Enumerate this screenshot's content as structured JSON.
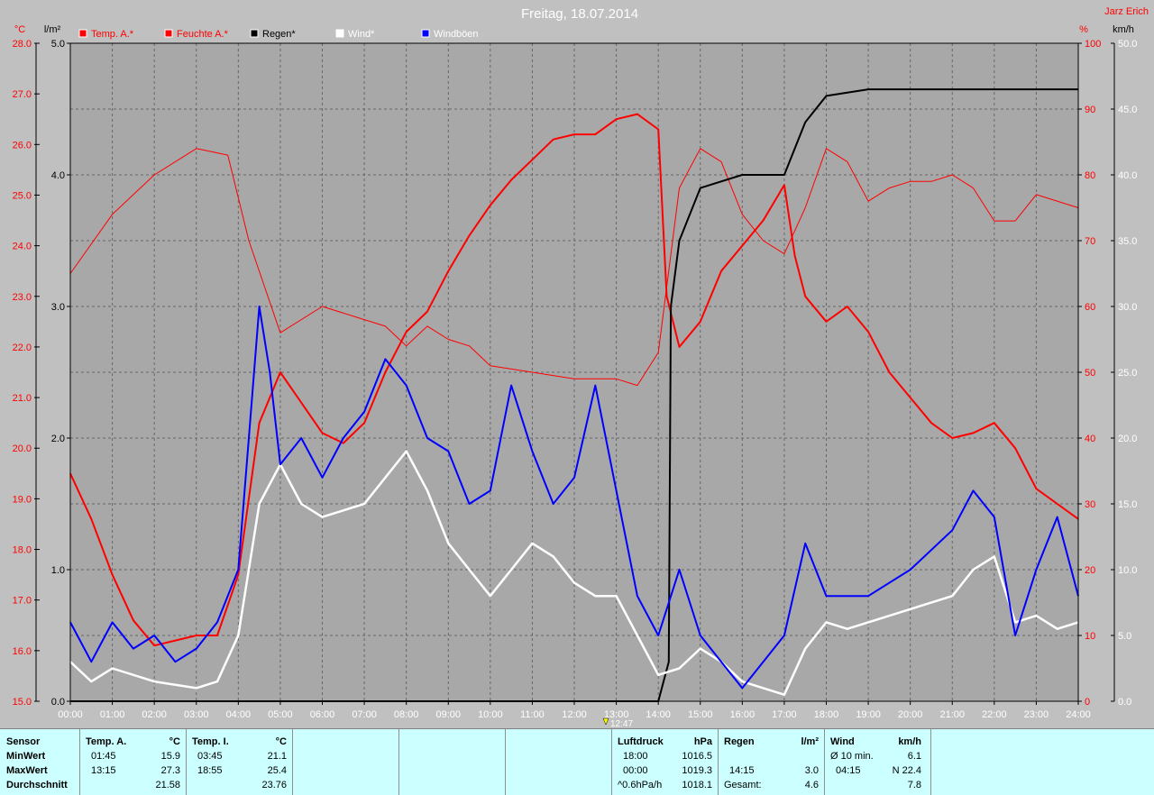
{
  "title": "Freitag, 18.07.2014",
  "author": "Jarz Erich",
  "units": {
    "temp": "°C",
    "rain": "l/m²",
    "hum": "%",
    "wind": "km/h"
  },
  "colors": {
    "temp": "#ff0000",
    "humidity": "#ff0000",
    "rain": "#000000",
    "wind": "#ffffff",
    "gust": "#0000ff",
    "plot_bg": "#a8a8a8",
    "accent_text": "#ff0000"
  },
  "legend": [
    {
      "label": "Temp. A.*",
      "color": "#ff0000"
    },
    {
      "label": "Feuchte A.*",
      "color": "#ff0000"
    },
    {
      "label": "Regen*",
      "color": "#000000"
    },
    {
      "label": "Wind*",
      "color": "#ffffff"
    },
    {
      "label": "Windböen",
      "color": "#0000ff"
    }
  ],
  "marker": {
    "label": "12:47"
  },
  "chart_data": {
    "type": "line",
    "title": "Freitag, 18.07.2014",
    "x_ticks": [
      "00:00",
      "01:00",
      "02:00",
      "03:00",
      "04:00",
      "05:00",
      "06:00",
      "07:00",
      "08:00",
      "09:00",
      "10:00",
      "11:00",
      "12:00",
      "13:00",
      "14:00",
      "15:00",
      "16:00",
      "17:00",
      "18:00",
      "19:00",
      "20:00",
      "21:00",
      "22:00",
      "23:00",
      "24:00"
    ],
    "axes": {
      "temp": {
        "label": "°C",
        "range": [
          15,
          28
        ],
        "ticks": [
          "15.0",
          "16.0",
          "17.0",
          "18.0",
          "19.0",
          "20.0",
          "21.0",
          "22.0",
          "23.0",
          "24.0",
          "25.0",
          "26.0",
          "27.0",
          "28.0"
        ]
      },
      "rain": {
        "label": "l/m²",
        "range": [
          0,
          5
        ],
        "ticks": [
          "0.0",
          "1.0",
          "2.0",
          "3.0",
          "4.0",
          "5.0"
        ]
      },
      "humidity": {
        "label": "%",
        "range": [
          0,
          100
        ],
        "ticks": [
          "0",
          "10",
          "20",
          "30",
          "40",
          "50",
          "60",
          "70",
          "80",
          "90",
          "100"
        ]
      },
      "wind": {
        "label": "km/h",
        "range": [
          0,
          50
        ],
        "ticks": [
          "0.0",
          "5.0",
          "10.0",
          "15.0",
          "20.0",
          "25.0",
          "30.0",
          "35.0",
          "40.0",
          "45.0",
          "50.0"
        ]
      }
    },
    "grid": true,
    "series": [
      {
        "name": "Temp. A.*",
        "axis": "temp",
        "color": "#ff0000",
        "width": 2,
        "points": [
          [
            0,
            19.5
          ],
          [
            0.5,
            18.6
          ],
          [
            1,
            17.5
          ],
          [
            1.5,
            16.6
          ],
          [
            2,
            16.1
          ],
          [
            2.5,
            16.2
          ],
          [
            3,
            16.3
          ],
          [
            3.5,
            16.3
          ],
          [
            4,
            17.5
          ],
          [
            4.5,
            20.5
          ],
          [
            5,
            21.5
          ],
          [
            5.5,
            20.9
          ],
          [
            6,
            20.3
          ],
          [
            6.5,
            20.1
          ],
          [
            7,
            20.5
          ],
          [
            7.5,
            21.5
          ],
          [
            8,
            22.3
          ],
          [
            8.5,
            22.7
          ],
          [
            9,
            23.5
          ],
          [
            9.5,
            24.2
          ],
          [
            10,
            24.8
          ],
          [
            10.5,
            25.3
          ],
          [
            11,
            25.7
          ],
          [
            11.5,
            26.1
          ],
          [
            12,
            26.2
          ],
          [
            12.5,
            26.2
          ],
          [
            13,
            26.5
          ],
          [
            13.5,
            26.6
          ],
          [
            14,
            26.3
          ],
          [
            14.2,
            23
          ],
          [
            14.5,
            22
          ],
          [
            15,
            22.5
          ],
          [
            15.5,
            23.5
          ],
          [
            16,
            24
          ],
          [
            16.5,
            24.5
          ],
          [
            17,
            25.2
          ],
          [
            17.25,
            23.8
          ],
          [
            17.5,
            23
          ],
          [
            18,
            22.5
          ],
          [
            18.5,
            22.8
          ],
          [
            19,
            22.3
          ],
          [
            19.5,
            21.5
          ],
          [
            20,
            21
          ],
          [
            20.5,
            20.5
          ],
          [
            21,
            20.2
          ],
          [
            21.5,
            20.3
          ],
          [
            22,
            20.5
          ],
          [
            22.5,
            20
          ],
          [
            23,
            19.2
          ],
          [
            23.5,
            18.9
          ],
          [
            24,
            18.6
          ]
        ]
      },
      {
        "name": "Feuchte A.*",
        "axis": "humidity",
        "color": "#ff0000",
        "width": 1,
        "points": [
          [
            0,
            65
          ],
          [
            1,
            74
          ],
          [
            2,
            80
          ],
          [
            3,
            84
          ],
          [
            3.75,
            83
          ],
          [
            4.25,
            70
          ],
          [
            5,
            56
          ],
          [
            6,
            60
          ],
          [
            7,
            58
          ],
          [
            7.5,
            57
          ],
          [
            8,
            54
          ],
          [
            8.5,
            57
          ],
          [
            9,
            55
          ],
          [
            9.5,
            54
          ],
          [
            10,
            51
          ],
          [
            11,
            50
          ],
          [
            12,
            49
          ],
          [
            13,
            49
          ],
          [
            13.5,
            48
          ],
          [
            14,
            53
          ],
          [
            14.5,
            78
          ],
          [
            15,
            84
          ],
          [
            15.5,
            82
          ],
          [
            16,
            74
          ],
          [
            16.5,
            70
          ],
          [
            17,
            68
          ],
          [
            17.5,
            75
          ],
          [
            18,
            84
          ],
          [
            18.5,
            82
          ],
          [
            19,
            76
          ],
          [
            19.5,
            78
          ],
          [
            20,
            79
          ],
          [
            20.5,
            79
          ],
          [
            21,
            80
          ],
          [
            21.5,
            78
          ],
          [
            22,
            73
          ],
          [
            22.5,
            73
          ],
          [
            23,
            77
          ],
          [
            24,
            75
          ]
        ]
      },
      {
        "name": "Regen*",
        "axis": "rain",
        "color": "#000000",
        "width": 2,
        "points": [
          [
            0,
            0
          ],
          [
            14,
            0
          ],
          [
            14.25,
            0.3
          ],
          [
            14.3,
            3
          ],
          [
            14.5,
            3.5
          ],
          [
            15,
            3.9
          ],
          [
            16,
            4.0
          ],
          [
            17,
            4.0
          ],
          [
            17.5,
            4.4
          ],
          [
            18,
            4.6
          ],
          [
            19,
            4.65
          ],
          [
            24,
            4.65
          ]
        ]
      },
      {
        "name": "Wind*",
        "axis": "wind",
        "color": "#ffffff",
        "width": 2.5,
        "points": [
          [
            0,
            3
          ],
          [
            0.5,
            1.5
          ],
          [
            1,
            2.5
          ],
          [
            2,
            1.5
          ],
          [
            3,
            1
          ],
          [
            3.5,
            1.5
          ],
          [
            4,
            5
          ],
          [
            4.5,
            15
          ],
          [
            5,
            18
          ],
          [
            5.5,
            15
          ],
          [
            6,
            14
          ],
          [
            7,
            15
          ],
          [
            7.5,
            17
          ],
          [
            8,
            19
          ],
          [
            8.5,
            16
          ],
          [
            9,
            12
          ],
          [
            9.5,
            10
          ],
          [
            10,
            8
          ],
          [
            10.5,
            10
          ],
          [
            11,
            12
          ],
          [
            11.5,
            11
          ],
          [
            12,
            9
          ],
          [
            12.5,
            8
          ],
          [
            13,
            8
          ],
          [
            13.5,
            5
          ],
          [
            14,
            2
          ],
          [
            14.5,
            2.5
          ],
          [
            15,
            4
          ],
          [
            15.5,
            3
          ],
          [
            16,
            1.5
          ],
          [
            16.5,
            1
          ],
          [
            17,
            0.5
          ],
          [
            17.5,
            4
          ],
          [
            18,
            6
          ],
          [
            18.5,
            5.5
          ],
          [
            19,
            6
          ],
          [
            20,
            7
          ],
          [
            21,
            8
          ],
          [
            21.5,
            10
          ],
          [
            22,
            11
          ],
          [
            22.5,
            6
          ],
          [
            23,
            6.5
          ],
          [
            23.5,
            5.5
          ],
          [
            24,
            6
          ]
        ]
      },
      {
        "name": "Windböen",
        "axis": "wind",
        "color": "#0000ff",
        "width": 2,
        "points": [
          [
            0,
            6
          ],
          [
            0.5,
            3
          ],
          [
            1,
            6
          ],
          [
            1.5,
            4
          ],
          [
            2,
            5
          ],
          [
            2.5,
            3
          ],
          [
            3,
            4
          ],
          [
            3.5,
            6
          ],
          [
            4,
            10
          ],
          [
            4.25,
            20
          ],
          [
            4.5,
            30
          ],
          [
            4.75,
            25
          ],
          [
            5,
            18
          ],
          [
            5.5,
            20
          ],
          [
            6,
            17
          ],
          [
            6.5,
            20
          ],
          [
            7,
            22
          ],
          [
            7.5,
            26
          ],
          [
            8,
            24
          ],
          [
            8.5,
            20
          ],
          [
            9,
            19
          ],
          [
            9.5,
            15
          ],
          [
            10,
            16
          ],
          [
            10.5,
            24
          ],
          [
            11,
            19
          ],
          [
            11.5,
            15
          ],
          [
            12,
            17
          ],
          [
            12.5,
            24
          ],
          [
            13,
            16
          ],
          [
            13.5,
            8
          ],
          [
            14,
            5
          ],
          [
            14.5,
            10
          ],
          [
            15,
            5
          ],
          [
            15.5,
            3
          ],
          [
            16,
            1
          ],
          [
            16.5,
            3
          ],
          [
            17,
            5
          ],
          [
            17.5,
            12
          ],
          [
            18,
            8
          ],
          [
            18.5,
            8
          ],
          [
            19,
            8
          ],
          [
            20,
            10
          ],
          [
            21,
            13
          ],
          [
            21.5,
            16
          ],
          [
            22,
            14
          ],
          [
            22.5,
            5
          ],
          [
            23,
            10
          ],
          [
            23.5,
            14
          ],
          [
            24,
            8
          ]
        ]
      }
    ]
  },
  "stats": {
    "sensor": {
      "header": "Sensor",
      "rows": [
        "MinWert",
        "MaxWert",
        "Durchschnitt"
      ]
    },
    "temp_a": {
      "header": "Temp. A.",
      "unit": "°C",
      "min_time": "01:45",
      "min_val": "15.9",
      "max_time": "13:15",
      "max_val": "27.3",
      "avg": "21.58"
    },
    "temp_i": {
      "header": "Temp. I.",
      "unit": "°C",
      "min_time": "03:45",
      "min_val": "21.1",
      "max_time": "18:55",
      "max_val": "25.4",
      "avg": "23.76"
    },
    "pressure": {
      "header": "Luftdruck",
      "unit": "hPa",
      "r1_time": "18:00",
      "r1_val": "1016.5",
      "r2_time": "00:00",
      "r2_val": "1019.3",
      "r3_time": "^0.6hPa/h",
      "r3_val": "1018.1"
    },
    "rain": {
      "header": "Regen",
      "unit": "l/m²",
      "r2_time": "14:15",
      "r2_val": "3.0",
      "r3_label": "Gesamt:",
      "r3_val": "4.6"
    },
    "wind": {
      "header": "Wind",
      "unit": "km/h",
      "r1_label": "Ø 10 min.",
      "r1_val": "6.1",
      "r2_time": "04:15",
      "r2_val": "N 22.4",
      "r3_val": "7.8"
    }
  }
}
